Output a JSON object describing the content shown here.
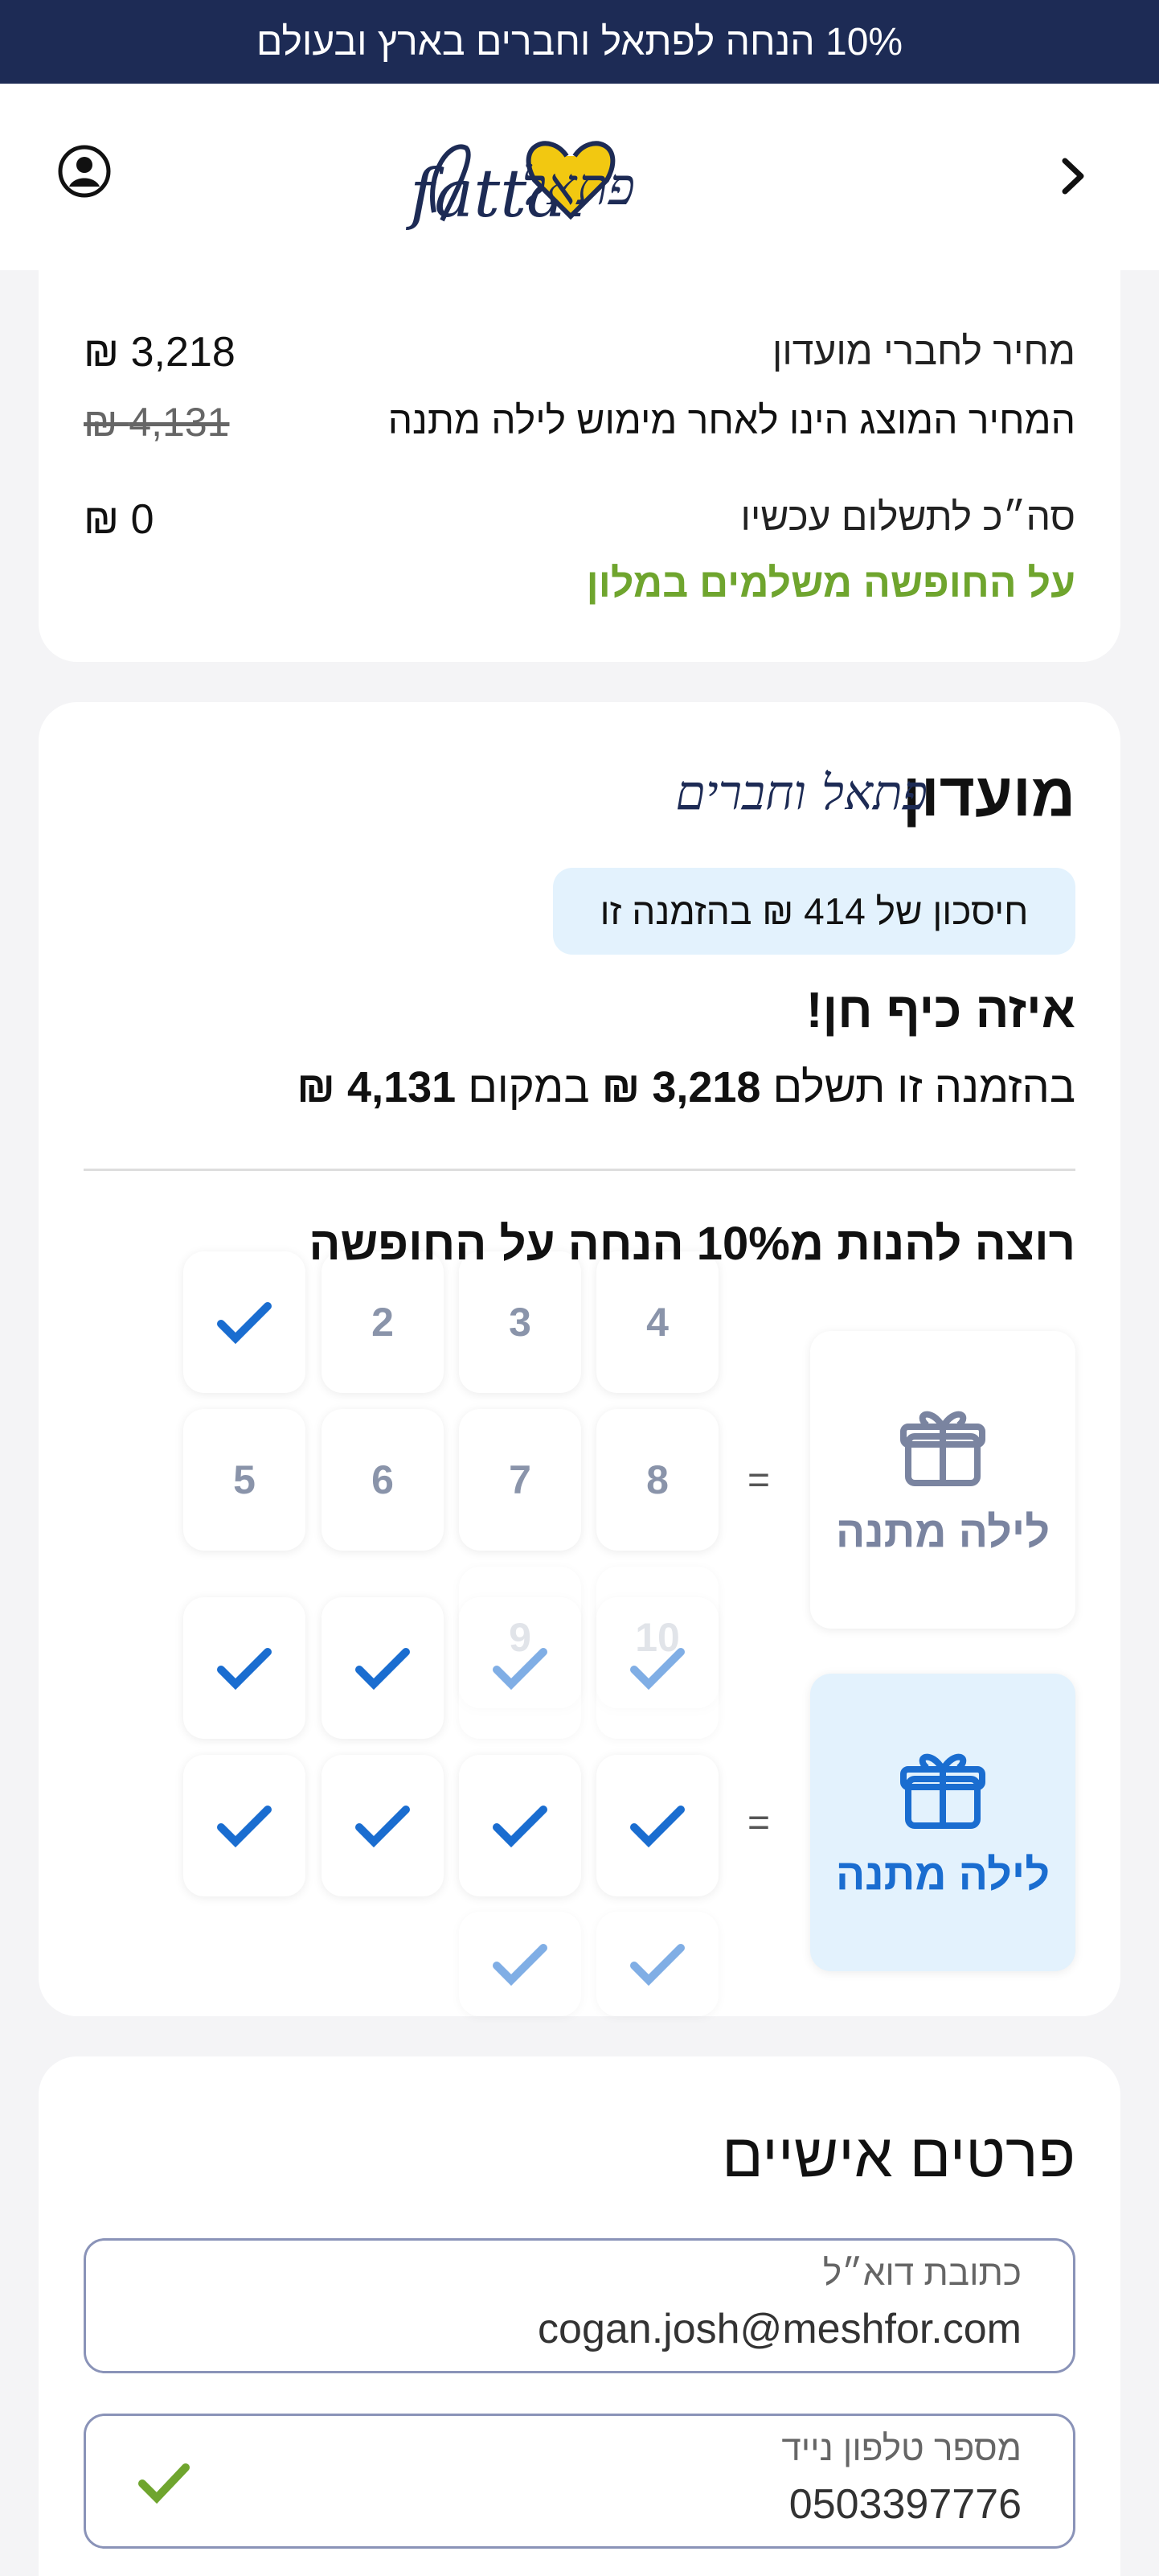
{
  "promo_bar": {
    "text": "10% הנחה לפתאל וחברים בארץ ובעולם"
  },
  "header": {
    "brand_he": "פתאל",
    "brand_en": "fattal"
  },
  "summary": {
    "member_price_label": "מחיר לחברי מועדון",
    "member_price_value": "3,218 ₪",
    "note_label": "המחיר המוצג הינו לאחר מימוש לילה מתנה",
    "original_price_value": "4,131 ₪",
    "total_now_label": "סה״כ לתשלום עכשיו",
    "total_now_value": "0 ₪",
    "pay_at_hotel": "על החופשה משלמים במלון"
  },
  "club": {
    "title": "מועדון",
    "logo_text": "פתאל וחברים",
    "savings_pill": "חיסכון של 414 ₪ בהזמנה זו",
    "headline": "איזה כיף חן!",
    "sentence_pre": "בהזמנה זו תשלם",
    "sentence_price": "3,218 ₪",
    "sentence_mid": "במקום",
    "sentence_orig": "4,131 ₪",
    "discount_title": "רוצה להנות מ10% הנחה על החופשה",
    "gift_label_1": "לילה מתנה",
    "gift_label_2": "לילה מתנה",
    "equals": "=",
    "grid_numbers": [
      "2",
      "3",
      "4",
      "5",
      "6",
      "7",
      "8",
      "9",
      "10"
    ]
  },
  "personal": {
    "title": "פרטים אישיים",
    "email_label": "כתובת דוא״ל",
    "email_value": "cogan.josh@meshfor.com",
    "phone_label": "מספר טלפון נייד",
    "phone_value": "0503397776"
  },
  "colors": {
    "navy": "#1d2b55",
    "accent_blue": "#1a6dd0",
    "green": "#6fa52e",
    "pill_bg": "#e3f2fd",
    "heart": "#f2c811"
  }
}
